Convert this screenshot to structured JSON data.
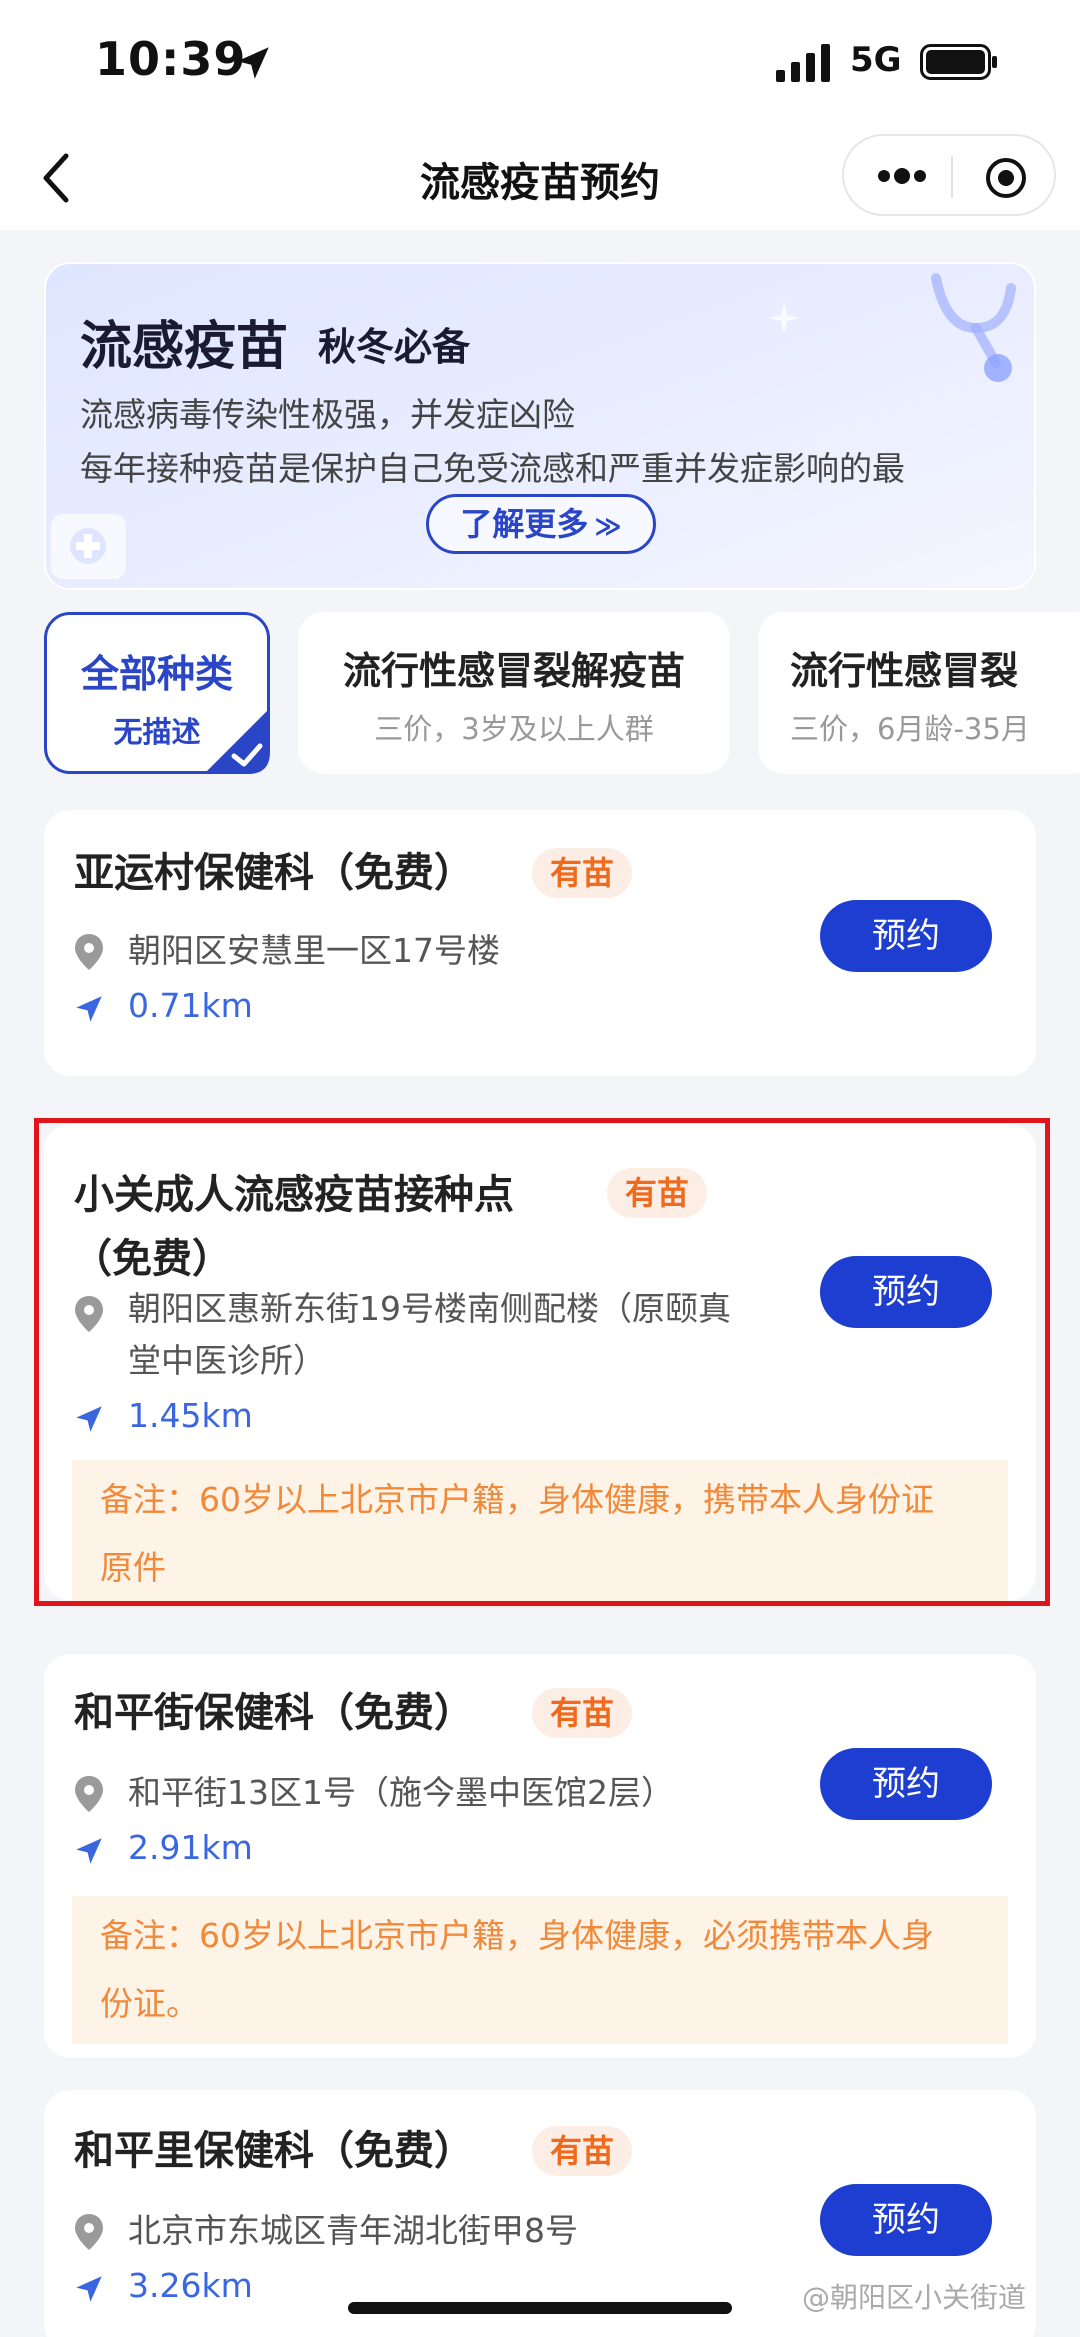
{
  "status_bar": {
    "time": "10:39",
    "network": "5G"
  },
  "nav": {
    "title": "流感疫苗预约"
  },
  "banner": {
    "title": "流感疫苗",
    "subtitle": "秋冬必备",
    "line1": "流感病毒传染性极强，并发症凶险",
    "line2": "每年接种疫苗是保护自己免受流感和严重并发症影响的最",
    "learn_more": "了解更多"
  },
  "tabs": [
    {
      "title": "全部种类",
      "desc": "无描述"
    },
    {
      "title": "流行性感冒裂解疫苗",
      "desc": "三价，3岁及以上人群"
    },
    {
      "title": "流行性感冒裂",
      "desc": "三价，6月龄-35月"
    }
  ],
  "sites": [
    {
      "name": "亚运村保健科（免费）",
      "badge": "有苗",
      "address": "朝阳区安慧里一区17号楼",
      "distance": "0.71km",
      "book": "预约"
    },
    {
      "name_line1": "小关成人流感疫苗接种点",
      "name_line2": "（免费）",
      "badge": "有苗",
      "address_line1": "朝阳区惠新东街19号楼南侧配楼（原颐真",
      "address_line2": "堂中医诊所）",
      "distance": "1.45km",
      "book": "预约",
      "note_line1": "备注：60岁以上北京市户籍，身体健康，携带本人身份证",
      "note_line2": "原件"
    },
    {
      "name": "和平街保健科（免费）",
      "badge": "有苗",
      "address": "和平街13区1号（施今墨中医馆2层）",
      "distance": "2.91km",
      "book": "预约",
      "note_line1": "备注：60岁以上北京市户籍，身体健康，必须携带本人身",
      "note_line2": "份证。"
    },
    {
      "name": "和平里保健科（免费）",
      "badge": "有苗",
      "address": "北京市东城区青年湖北街甲8号",
      "distance": "3.26km",
      "book": "预约"
    }
  ],
  "watermark": "@朝阳区小关街道",
  "colors": {
    "primary": "#1d3ed1",
    "badge_text": "#f06a1d",
    "note_bg": "#fdf3e6",
    "highlight": "#e0141b"
  }
}
